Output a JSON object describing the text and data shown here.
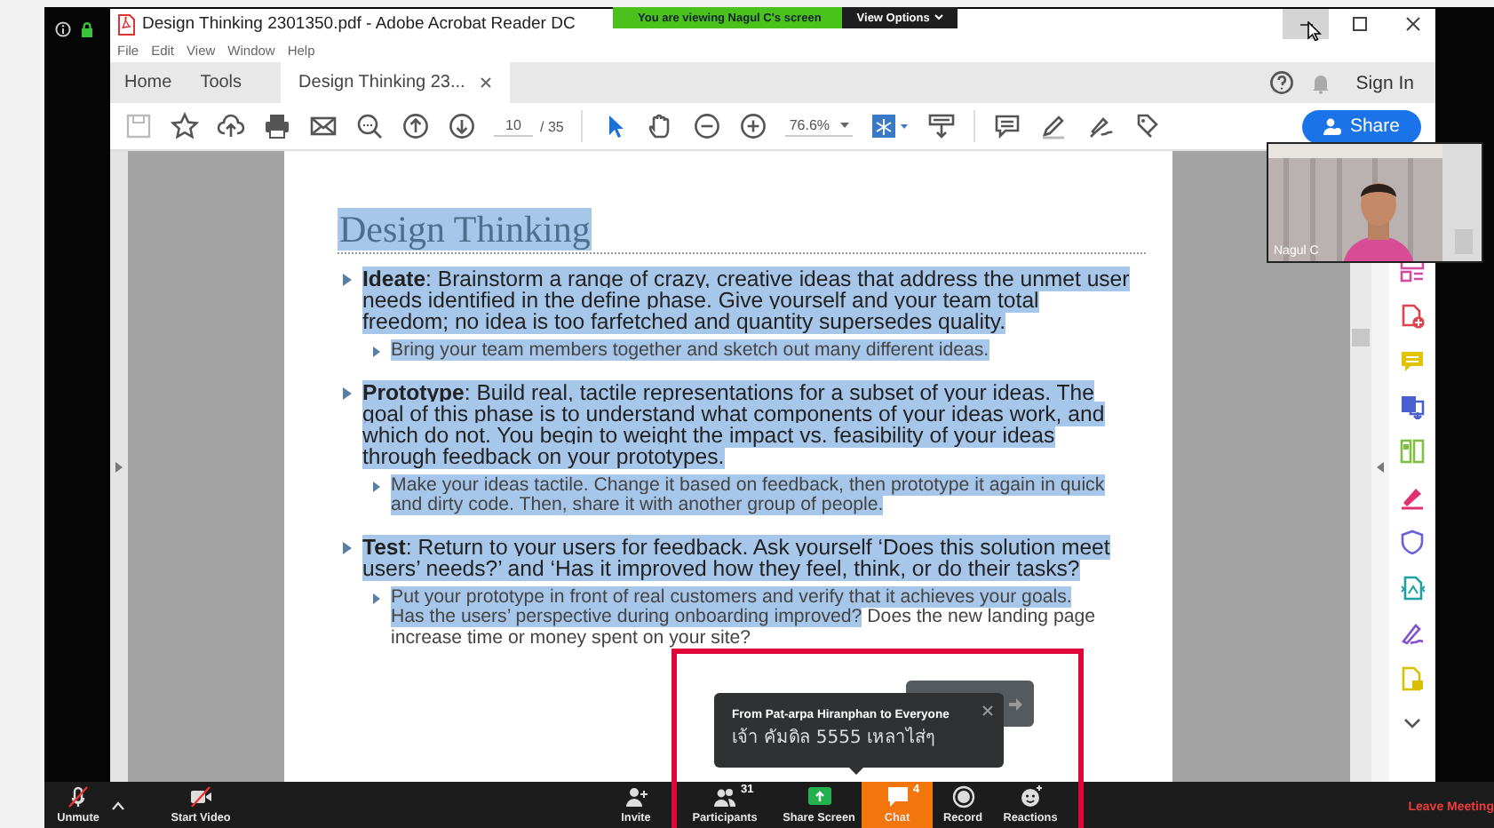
{
  "share_banner": {
    "text": "You are viewing Nagul C's screen",
    "options": "View Options"
  },
  "acrobat": {
    "title": "Design Thinking 2301350.pdf - Adobe Acrobat Reader DC",
    "menu": [
      "File",
      "Edit",
      "View",
      "Window",
      "Help"
    ],
    "tabs": [
      {
        "label": "Home",
        "selected": false
      },
      {
        "label": "Tools",
        "selected": false
      },
      {
        "label": "Design Thinking 23...",
        "selected": true
      }
    ],
    "sign_in": "Sign In",
    "page_number": "10",
    "page_total": "/ 35",
    "zoom_level": "76.6%",
    "share_button": "Share"
  },
  "document": {
    "heading": "Design Thinking",
    "heading_highlighted": true,
    "sections": [
      {
        "segments": [
          {
            "text": "**Ideate**: Brainstorm a range of crazy, creative ideas that address the unmet user needs identified in the define phase. Give yourself and your team total freedom; no idea is too farfetched and quantity supersedes quality.",
            "highlighted": true
          }
        ],
        "sub": [
          {
            "text": "Bring your team members together and sketch out many different ideas.",
            "highlighted": true
          }
        ]
      },
      {
        "segments": [
          {
            "text": "**Prototype**: Build real, tactile representations for a subset of your ideas. The goal of this phase is to understand what components of your ideas work, and which do not. You begin to weight the impact vs. feasibility of your ideas through feedback on your prototypes.",
            "highlighted": true
          }
        ],
        "sub": [
          {
            "text": "Make your ideas tactile. Change it based on feedback, then prototype it again in quick and dirty code. Then, share it with another group of people.",
            "highlighted": true
          }
        ]
      },
      {
        "segments": [
          {
            "text": "**Test**: Return to your users for feedback. Ask yourself ‘Does this solution meet users’ needs?’ and ‘Has it improved how they feel, think, or do their tasks?",
            "highlighted": true
          }
        ],
        "sub": [
          {
            "text": "Put your prototype in front of real customers and verify that it achieves your goals. Has the users’ perspective during onboarding improved?",
            "highlighted": true
          },
          {
            "text": " Does the new landing page increase time or money spent on your site?",
            "highlighted": false
          }
        ]
      }
    ]
  },
  "video_tile": {
    "name": "Nagul C"
  },
  "chat_popup": {
    "sender": "From Pat-arpa Hiranphan to Everyone",
    "message": "เจ้า คัมดิล 5555 เหลาไส่ๆ"
  },
  "toolbar": {
    "items": [
      {
        "kind": "mic",
        "label": "Unmute",
        "muted": true,
        "active": false
      },
      {
        "kind": "video",
        "label": "Start Video",
        "muted": true,
        "active": false
      },
      {
        "kind": "invite",
        "label": "Invite",
        "active": false
      },
      {
        "kind": "participants",
        "label": "Participants",
        "count": "31",
        "active": false
      },
      {
        "kind": "share",
        "label": "Share Screen",
        "active": false
      },
      {
        "kind": "chat",
        "label": "Chat",
        "count": "4",
        "active": true
      },
      {
        "kind": "record",
        "label": "Record",
        "active": false
      },
      {
        "kind": "reactions",
        "label": "Reactions",
        "active": false
      }
    ],
    "leave": "Leave Meeting"
  }
}
